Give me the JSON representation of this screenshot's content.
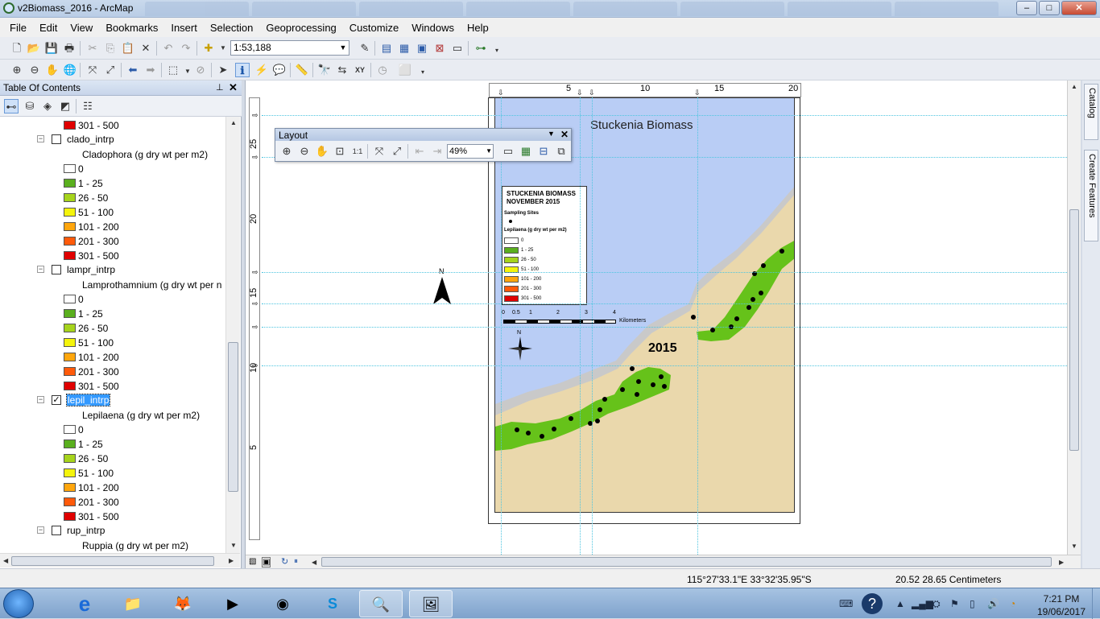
{
  "window": {
    "title": "v2Biomass_2016 - ArcMap",
    "min": "–",
    "max": "□",
    "close": "✕"
  },
  "menu": [
    "File",
    "Edit",
    "View",
    "Bookmarks",
    "Insert",
    "Selection",
    "Geoprocessing",
    "Customize",
    "Windows",
    "Help"
  ],
  "toolbar": {
    "scale": "1:53,188"
  },
  "toc": {
    "title": "Table Of Contents",
    "pin": "⊥",
    "close": "✕",
    "rows": [
      {
        "type": "class",
        "label": "301 - 500",
        "color": "#e00000"
      },
      {
        "type": "layer",
        "name": "clado_intrp",
        "checked": false,
        "selected": false
      },
      {
        "type": "field",
        "label": "Cladophora (g dry wt per m2)"
      },
      {
        "type": "class",
        "label": "0",
        "color": "#ffffff"
      },
      {
        "type": "class",
        "label": "1 - 25",
        "color": "#5aaf1e"
      },
      {
        "type": "class",
        "label": "26 - 50",
        "color": "#a6d41c"
      },
      {
        "type": "class",
        "label": "51 - 100",
        "color": "#f4f40c"
      },
      {
        "type": "class",
        "label": "101 - 200",
        "color": "#ffa60d"
      },
      {
        "type": "class",
        "label": "201 - 300",
        "color": "#ff5a0a"
      },
      {
        "type": "class",
        "label": "301 - 500",
        "color": "#e00000"
      },
      {
        "type": "layer",
        "name": "lampr_intrp",
        "checked": false,
        "selected": false
      },
      {
        "type": "field",
        "label": "Lamprothamnium (g dry wt per n"
      },
      {
        "type": "class",
        "label": "0",
        "color": "#ffffff"
      },
      {
        "type": "class",
        "label": "1 - 25",
        "color": "#5aaf1e"
      },
      {
        "type": "class",
        "label": "26 - 50",
        "color": "#a6d41c"
      },
      {
        "type": "class",
        "label": "51 - 100",
        "color": "#f4f40c"
      },
      {
        "type": "class",
        "label": "101 - 200",
        "color": "#ffa60d"
      },
      {
        "type": "class",
        "label": "201 - 300",
        "color": "#ff5a0a"
      },
      {
        "type": "class",
        "label": "301 - 500",
        "color": "#e00000"
      },
      {
        "type": "layer",
        "name": "lepil_intrp",
        "checked": true,
        "selected": true
      },
      {
        "type": "field",
        "label": "Lepilaena (g dry wt per m2)"
      },
      {
        "type": "class",
        "label": "0",
        "color": "#ffffff"
      },
      {
        "type": "class",
        "label": "1 - 25",
        "color": "#5aaf1e"
      },
      {
        "type": "class",
        "label": "26 - 50",
        "color": "#a6d41c"
      },
      {
        "type": "class",
        "label": "51 - 100",
        "color": "#f4f40c"
      },
      {
        "type": "class",
        "label": "101 - 200",
        "color": "#ffa60d"
      },
      {
        "type": "class",
        "label": "201 - 300",
        "color": "#ff5a0a"
      },
      {
        "type": "class",
        "label": "301 - 500",
        "color": "#e00000"
      },
      {
        "type": "layer",
        "name": "rup_intrp",
        "checked": false,
        "selected": false
      },
      {
        "type": "field",
        "label": "Ruppia (g dry wt per m2)"
      }
    ]
  },
  "ruler": {
    "top_ticks": [
      "5",
      "10",
      "15",
      "20"
    ],
    "left_ticks": [
      "25",
      "20",
      "15",
      "10",
      "5"
    ]
  },
  "layout_toolbar": {
    "title": "Layout",
    "zoom": "49%"
  },
  "map": {
    "title": "Stuckenia Biomass",
    "year": "2015",
    "north_label": "N",
    "legend": {
      "title_line1": "STUCKENIA BIOMASS",
      "title_line2": "NOVEMBER 2015",
      "sites_label": "Sampling Sites",
      "field_label": "Lepilaena (g dry wt per m2)",
      "classes": [
        {
          "label": "0",
          "color": "#ffffff"
        },
        {
          "label": "1 - 25",
          "color": "#5aaf1e"
        },
        {
          "label": "26 - 50",
          "color": "#a6d41c"
        },
        {
          "label": "51 - 100",
          "color": "#f4f40c"
        },
        {
          "label": "101 - 200",
          "color": "#ffa60d"
        },
        {
          "label": "201 - 300",
          "color": "#ff5a0a"
        },
        {
          "label": "301 - 500",
          "color": "#e00000"
        }
      ]
    },
    "scalebar": {
      "ticks": [
        "0",
        "0.5",
        "1",
        "2",
        "3",
        "4"
      ],
      "unit": "Kilometers"
    },
    "colors": {
      "water": "#b9cdf5",
      "land": "#ead8ac",
      "vegetation": "#66c21a"
    }
  },
  "status": {
    "coords": "115°27'33.1\"E  33°32'35.95\"S",
    "page_coords": "20.52  28.65 Centimeters"
  },
  "dock": {
    "catalog": "Catalog",
    "create_features": "Create Features"
  },
  "taskbar": {
    "time": "7:21 PM",
    "date": "19/06/2017"
  }
}
